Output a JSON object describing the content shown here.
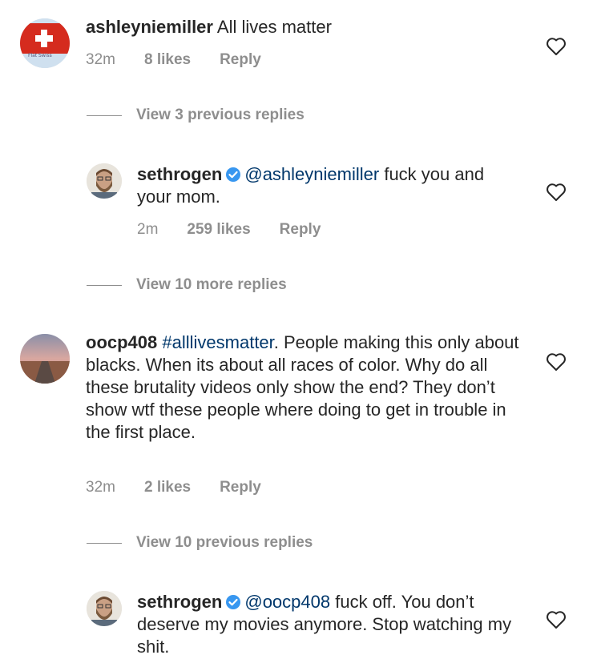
{
  "comments": [
    {
      "username": "ashleyniemiller",
      "text": "All lives matter",
      "time": "32m",
      "likes": "8 likes",
      "reply": "Reply",
      "avatar_text": "Flat Swiss"
    },
    {
      "username": "sethrogen",
      "mention": "@ashleyniemiller",
      "text": "fuck you and your mom.",
      "time": "2m",
      "likes": "259 likes",
      "reply": "Reply"
    },
    {
      "username": "oocp408",
      "hashtag": "#alllivesmatter",
      "text": ".  People making this only about blacks. When its about all races of color. Why do all these brutality videos only show the end? They don’t show wtf these people where doing to get in trouble in the first place.",
      "time": "32m",
      "likes": "2 likes",
      "reply": "Reply"
    },
    {
      "username": "sethrogen",
      "mention": "@oocp408",
      "text": "fuck off. You don’t deserve my movies anymore. Stop watching my shit."
    }
  ],
  "view_replies": [
    "View 3 previous replies",
    "View 10 more replies",
    "View 10 previous replies"
  ],
  "colors": {
    "text": "#262626",
    "muted": "#8e8e8e",
    "link": "#00376b",
    "verified": "#3897f0"
  },
  "icons": [
    "heart-icon",
    "verified-badge-icon",
    "avatar"
  ]
}
